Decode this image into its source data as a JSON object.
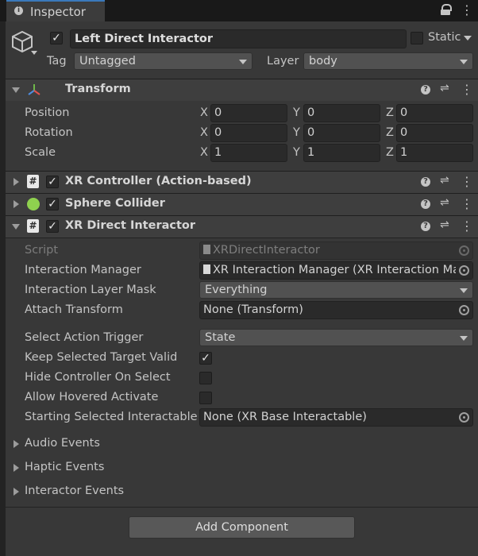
{
  "tab": {
    "title": "Inspector"
  },
  "object": {
    "name": "Left Direct Interactor",
    "static_label": "Static",
    "tag_label": "Tag",
    "tag_value": "Untagged",
    "layer_label": "Layer",
    "layer_value": "body"
  },
  "transform": {
    "title": "Transform",
    "position_label": "Position",
    "rotation_label": "Rotation",
    "scale_label": "Scale",
    "axis_x": "X",
    "axis_y": "Y",
    "axis_z": "Z",
    "position": {
      "x": "0",
      "y": "0",
      "z": "0"
    },
    "rotation": {
      "x": "0",
      "y": "0",
      "z": "0"
    },
    "scale": {
      "x": "1",
      "y": "1",
      "z": "1"
    }
  },
  "components": {
    "xr_controller": "XR Controller (Action-based)",
    "sphere_collider": "Sphere Collider",
    "xr_direct_interactor": "XR Direct Interactor"
  },
  "interactor": {
    "script_label": "Script",
    "script_value": "XRDirectInteractor",
    "interaction_manager_label": "Interaction Manager",
    "interaction_manager_value": "XR Interaction Manager (XR Interaction Ma",
    "layer_mask_label": "Interaction Layer Mask",
    "layer_mask_value": "Everything",
    "attach_transform_label": "Attach Transform",
    "attach_transform_value": "None (Transform)",
    "select_trigger_label": "Select Action Trigger",
    "select_trigger_value": "State",
    "keep_selected_label": "Keep Selected Target Valid",
    "hide_controller_label": "Hide Controller On Select",
    "allow_hovered_label": "Allow Hovered Activate",
    "starting_selected_label": "Starting Selected Interactable",
    "starting_selected_value": "None (XR Base Interactable)"
  },
  "events": {
    "audio": "Audio Events",
    "haptic": "Haptic Events",
    "interactor": "Interactor Events"
  },
  "add_component_label": "Add Component",
  "colors": {
    "panel_bg": "#383838",
    "header_bg": "#3e3e3e",
    "field_bg": "#2a2a2a",
    "tab_accent": "#3a79bb",
    "collider_icon": "#8fd14f"
  }
}
